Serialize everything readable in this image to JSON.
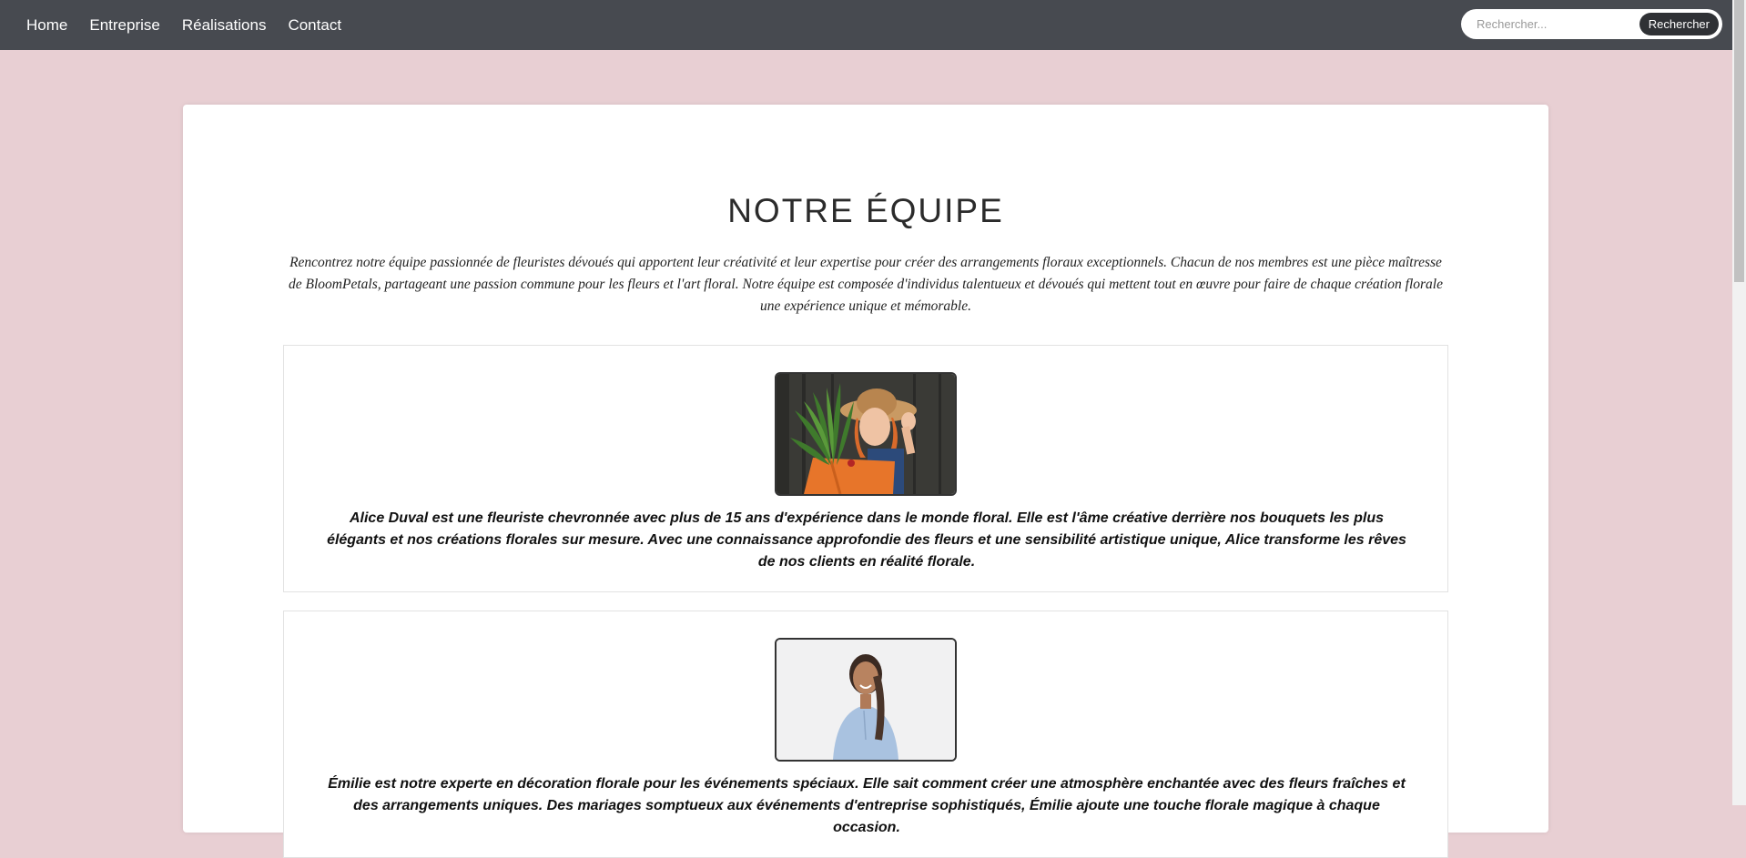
{
  "nav": {
    "items": [
      {
        "label": "Home"
      },
      {
        "label": "Entreprise"
      },
      {
        "label": "Réalisations"
      },
      {
        "label": "Contact"
      }
    ]
  },
  "search": {
    "placeholder": "Rechercher...",
    "button_label": "Rechercher"
  },
  "page": {
    "title": "NOTRE ÉQUIPE",
    "intro": "Rencontrez notre équipe passionnée de fleuristes dévoués qui apportent leur créativité et leur expertise pour créer des arrangements floraux exceptionnels. Chacun de nos membres est une pièce maîtresse de BloomPetals, partageant une passion commune pour les fleurs et l'art floral. Notre équipe est composée d'individus talentueux et dévoués qui mettent tout en œuvre pour faire de chaque création florale une expérience unique et mémorable."
  },
  "members": [
    {
      "bio": "Alice Duval est une fleuriste chevronnée avec plus de 15 ans d'expérience dans le monde floral. Elle est l'âme créative derrière nos bouquets les plus élégants et nos créations florales sur mesure. Avec une connaissance approfondie des fleurs et une sensibilité artistique unique, Alice transforme les rêves de nos clients en réalité florale."
    },
    {
      "bio": "Émilie est notre experte en décoration florale pour les événements spéciaux. Elle sait comment créer une atmosphère enchantée avec des fleurs fraîches et des arrangements uniques. Des mariages somptueux aux événements d'entreprise sophistiqués, Émilie ajoute une touche florale magique à chaque occasion."
    }
  ],
  "colors": {
    "topbar": "#474a50",
    "page_background": "#e8cfd3",
    "search_button": "#2f3135"
  }
}
